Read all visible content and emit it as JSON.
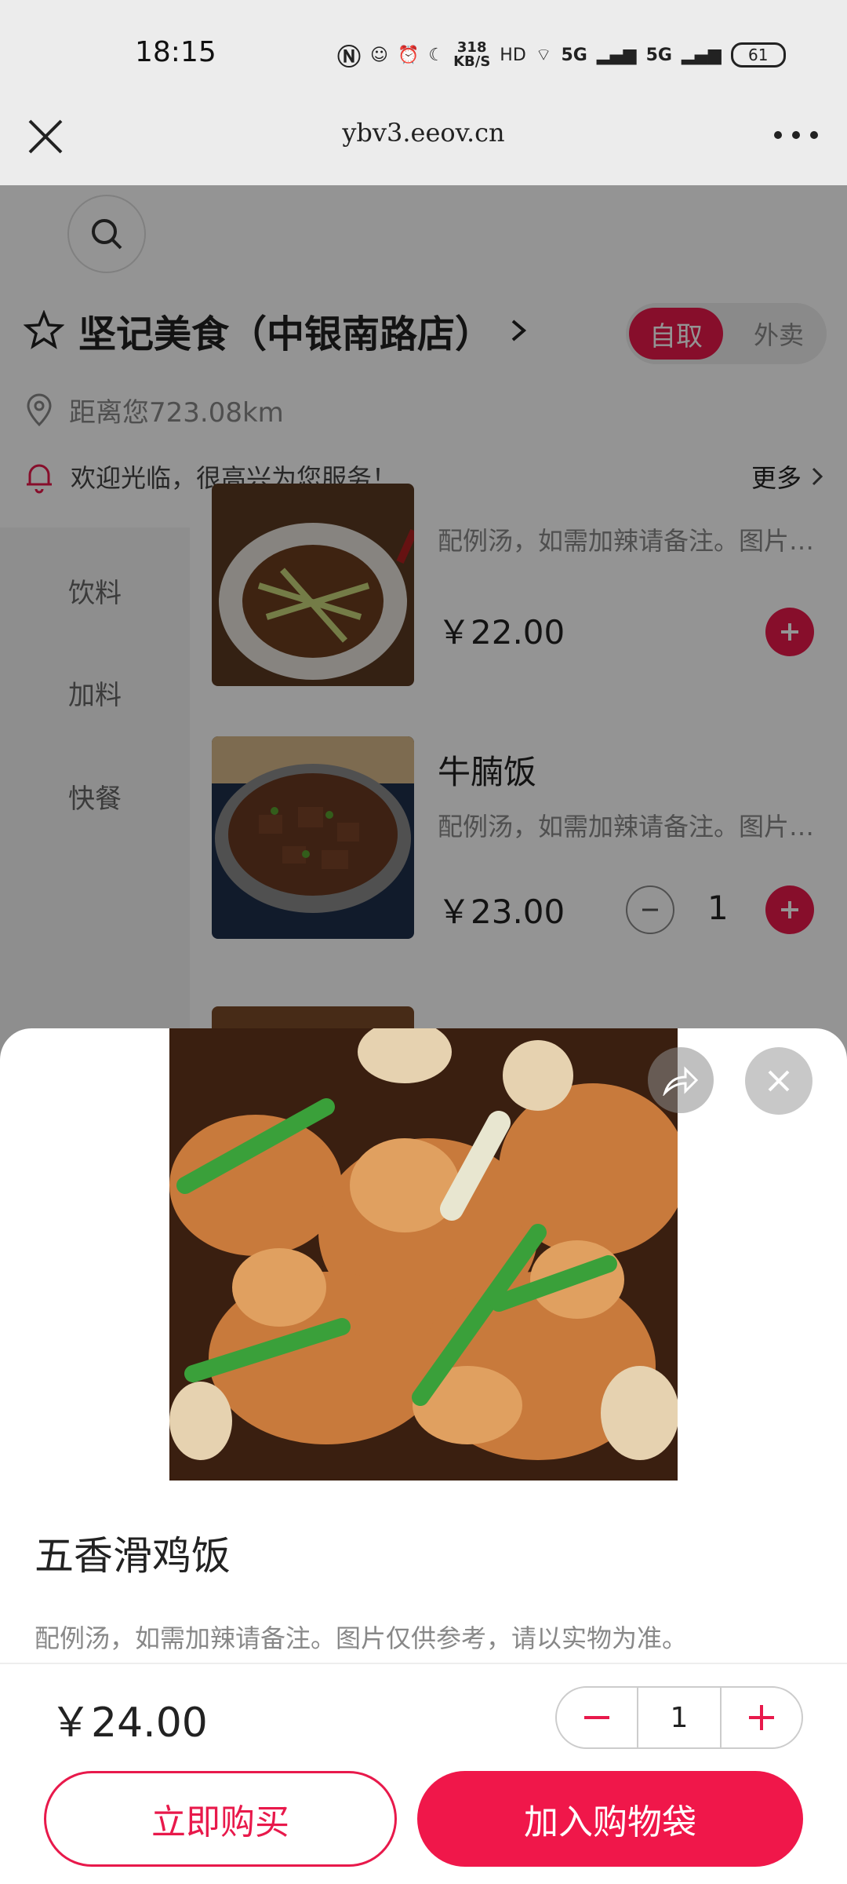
{
  "status_bar": {
    "time": "18:15",
    "net_speed_value": "318",
    "net_speed_unit": "KB/S",
    "signal_1": "5G",
    "signal_2": "5G",
    "battery": "61"
  },
  "browser": {
    "url": "ybv3.eeov.cn",
    "close_icon": "close-icon",
    "more_icon": "more-dots-icon"
  },
  "shop": {
    "name": "坚记美食（中银南路店）",
    "distance": "距离您723.08km",
    "notice": "欢迎光临，很高兴为您服务！",
    "notice_more": "更多",
    "mode_active": "自取",
    "mode_inactive": "外卖"
  },
  "categories": [
    "饮料",
    "加料",
    "快餐"
  ],
  "foods": [
    {
      "desc": "配例汤，如需加辣请备注。图片仅供参考，请以实物为准。",
      "price": "￥22.00"
    },
    {
      "title": "牛腩饭",
      "desc": "配例汤，如需加辣请备注。图片仅供参考，请以实物为准。",
      "price": "￥23.00",
      "qty": "1"
    }
  ],
  "detail": {
    "name": "五香滑鸡饭",
    "desc": "配例汤，如需加辣请备注。图片仅供参考，请以实物为准。",
    "price": "￥24.00",
    "qty": "1",
    "buy_now": "立即购买",
    "add_to_bag": "加入购物袋"
  },
  "colors": {
    "accent": "#e8194b"
  }
}
